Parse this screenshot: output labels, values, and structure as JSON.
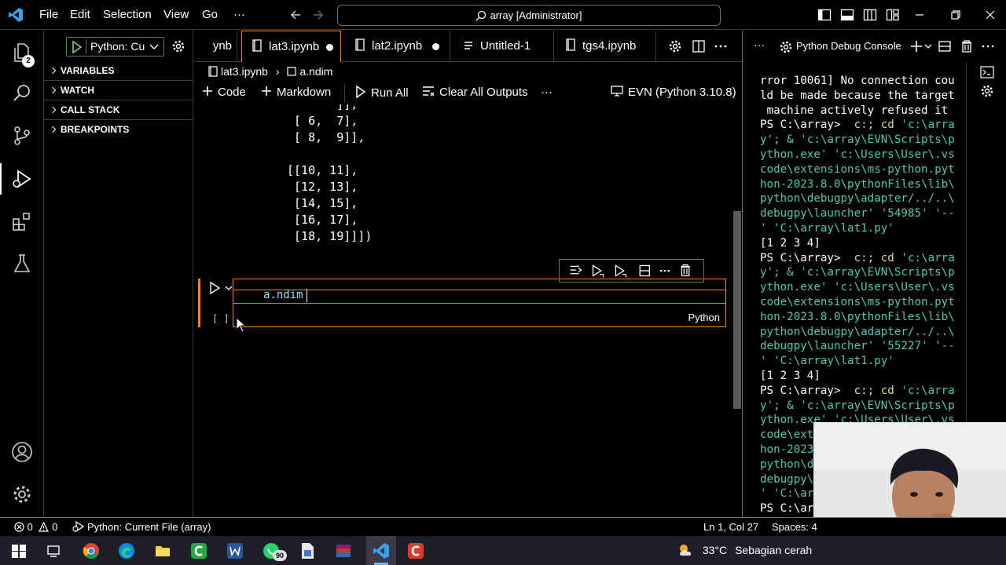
{
  "menu": {
    "file": "File",
    "edit": "Edit",
    "selection": "Selection",
    "view": "View",
    "go": "Go",
    "more": "···"
  },
  "command_center": {
    "label": "array [Administrator]"
  },
  "activity": {
    "extensions_badge": "2"
  },
  "debug": {
    "config_label": "Python: Cu",
    "sections": {
      "variables": "VARIABLES",
      "watch": "WATCH",
      "call_stack": "CALL STACK",
      "breakpoints": "BREAKPOINTS"
    }
  },
  "tabs": [
    {
      "label": "ynb"
    },
    {
      "label": "lat3.ipynb"
    },
    {
      "label": "lat2.ipynb"
    },
    {
      "label": "Untitled-1"
    },
    {
      "label": "tgs4.ipynb"
    }
  ],
  "breadcrumb": {
    "file": "lat3.ipynb",
    "symbol": "a.ndim"
  },
  "notebook_toolbar": {
    "code": "Code",
    "markdown": "Markdown",
    "run_all": "Run All",
    "clear_outputs": "Clear All Outputs",
    "more": "···",
    "kernel": "EVN (Python 3.10.8)"
  },
  "output_text": "       ]],\n [ 6,  7],\n [ 8,  9]],\n\n[[10, 11],\n [12, 13],\n [14, 15],\n [16, 17],\n [18, 19]]])",
  "cell": {
    "code": "a.ndim",
    "exec_count": "[ ]",
    "language": "Python"
  },
  "panel": {
    "title": "Python Debug Console",
    "more": "···"
  },
  "terminal": {
    "lines": [
      "rror 10061] No connection cou",
      "ld be made because the target",
      " machine actively refused it",
      "PS C:\\array>  c:; cd 'c:\\arra",
      "y'; & 'c:\\array\\EVN\\Scripts\\p",
      "ython.exe' 'c:\\Users\\User\\.vs",
      "code\\extensions\\ms-python.pyt",
      "hon-2023.8.0\\pythonFiles\\lib\\",
      "python\\debugpy\\adapter/../..\\",
      "debugpy\\launcher' '54985' '--",
      "' 'C:\\array\\lat1.py'",
      "[1 2 3 4]",
      "PS C:\\array>  c:; cd 'c:\\arra",
      "y'; & 'c:\\array\\EVN\\Scripts\\p",
      "ython.exe' 'c:\\Users\\User\\.vs",
      "code\\extensions\\ms-python.pyt",
      "hon-2023.8.0\\pythonFiles\\lib\\",
      "python\\debugpy\\adapter/../..\\",
      "debugpy\\launcher' '55227' '--",
      "' 'C:\\array\\lat1.py'",
      "[1 2 3 4]",
      "PS C:\\array>  c:; cd 'c:\\arra",
      "y'; & 'c:\\array\\EVN\\Scripts\\p",
      "ython.exe' 'c:\\Users\\User\\.vs",
      "code\\ext",
      "hon-2023",
      "python\\d",
      "debugpy\\",
      "' 'C:\\ar",
      "PS C:\\ar"
    ]
  },
  "statusbar": {
    "errors": "0",
    "warnings": "0",
    "debug_config": "Python: Current File (array)",
    "cursor_pos": "Ln 1, Col 27",
    "spaces": "Spaces: 4"
  },
  "taskbar": {
    "whatsapp_badge": "90",
    "temperature": "33°C",
    "weather": "Sebagian cerah"
  },
  "colors": {
    "accent": "#f38518",
    "string": "#4ec9b0",
    "background": "#000000"
  }
}
